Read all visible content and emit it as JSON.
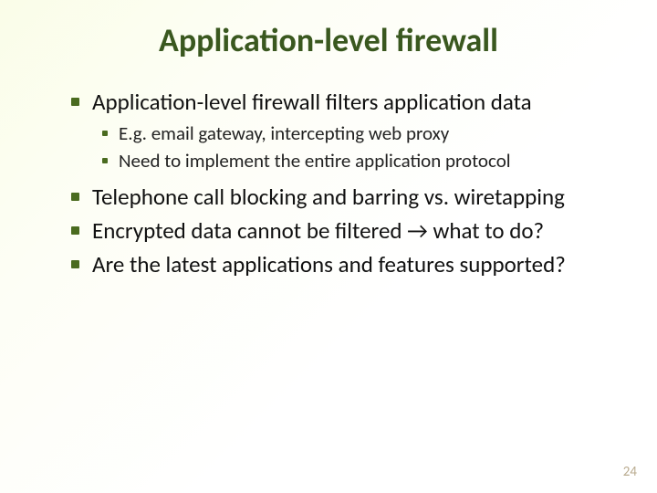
{
  "title": "Application-level firewall",
  "bullets": {
    "b0": "Application-level firewall filters application data",
    "b0_sub0": "E.g. email gateway, intercepting web proxy",
    "b0_sub1": "Need to implement the entire application protocol",
    "b1": "Telephone call blocking and barring vs. wiretapping",
    "b2": "Encrypted data cannot be filtered → what to do?",
    "b3": "Are the latest applications and features supported?"
  },
  "page_number": "24"
}
